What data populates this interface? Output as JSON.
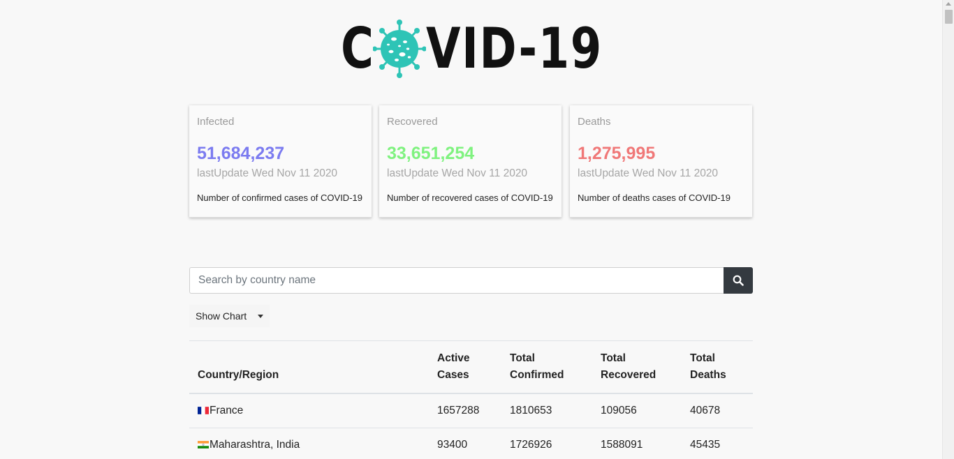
{
  "logo": {
    "text_before": "C",
    "text_after": "VID-19"
  },
  "cards": [
    {
      "title": "Infected",
      "value": "51,684,237",
      "date": "lastUpdate Wed Nov 11 2020",
      "desc": "Number of confirmed cases of COVID-19",
      "color": "#7b7bf0"
    },
    {
      "title": "Recovered",
      "value": "33,651,254",
      "date": "lastUpdate Wed Nov 11 2020",
      "desc": "Number of recovered cases of COVID-19",
      "color": "#7ff27f"
    },
    {
      "title": "Deaths",
      "value": "1,275,995",
      "date": "lastUpdate Wed Nov 11 2020",
      "desc": "Number of deaths cases of COVID-19",
      "color": "#f07878"
    }
  ],
  "search": {
    "placeholder": "Search by country name"
  },
  "show_chart": {
    "label": "Show Chart"
  },
  "table": {
    "headers": [
      "Country/Region",
      "Active Cases",
      "Total Confirmed",
      "Total Recovered",
      "Total Deaths"
    ],
    "rows": [
      {
        "country": "France",
        "flag": "france-flag-icon",
        "active": "1657288",
        "confirmed": "1810653",
        "recovered": "109056",
        "deaths": "40678"
      },
      {
        "country": "Maharashtra, India",
        "flag": "india-flag-icon",
        "active": "93400",
        "confirmed": "1726926",
        "recovered": "1588091",
        "deaths": "45435"
      }
    ]
  }
}
